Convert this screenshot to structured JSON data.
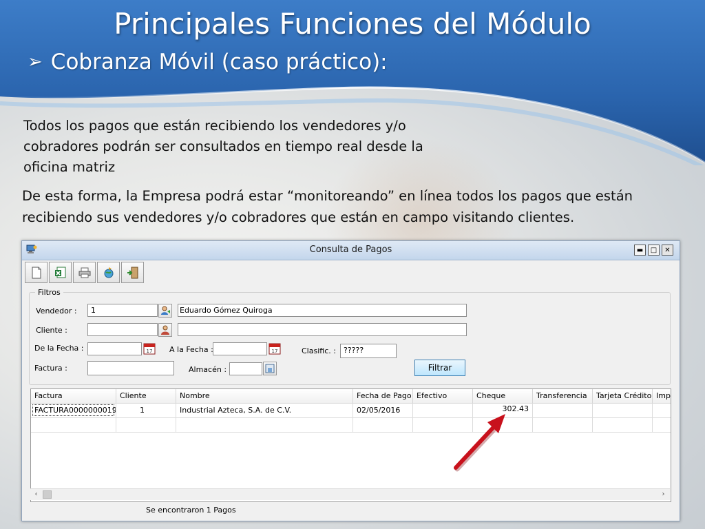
{
  "slide": {
    "title": "Principales Funciones del Módulo",
    "subtitle": "Cobranza Móvil (caso práctico):",
    "paragraph1": "Todos los pagos que están recibiendo los vendedores y/o cobradores podrán ser consultados en tiempo real desde la oficina matriz",
    "paragraph2": "De esta forma, la Empresa podrá estar “monitoreando” en línea todos los pagos que están recibiendo sus vendedores y/o cobradores que están en campo visitando clientes."
  },
  "window": {
    "title": "Consulta de Pagos",
    "controls": {
      "minimize": "▬",
      "maximize": "□",
      "close": "✕"
    }
  },
  "toolbar": {
    "icons": [
      "new-document-icon",
      "excel-export-icon",
      "printer-icon",
      "globe-refresh-icon",
      "exit-door-icon"
    ]
  },
  "filters": {
    "legend": "Filtros",
    "vendedor_label": "Vendedor :",
    "vendedor_value": "1",
    "vendedor_name": "Eduardo Gómez Quiroga",
    "cliente_label": "Cliente :",
    "cliente_value": "",
    "cliente_name": "",
    "de_fecha_label": "De la Fecha :",
    "a_fecha_label": "A la Fecha :",
    "clasif_label": "Clasific. :",
    "clasif_value": "?????",
    "factura_label": "Factura :",
    "almacen_label": "Almacén :",
    "filtrar_label": "Filtrar"
  },
  "grid": {
    "columns": [
      "Factura",
      "Cliente",
      "Nombre",
      "Fecha de Pago",
      "Efectivo",
      "Cheque",
      "Transferencia",
      "Tarjeta Crédito",
      "Imp"
    ],
    "row": {
      "factura": "FACTURA0000000019",
      "cliente": "1",
      "nombre": "Industrial Azteca, S.A. de C.V.",
      "fecha": "02/05/2016",
      "efectivo": "",
      "cheque": "302.43",
      "transferencia": "",
      "tarjeta": "",
      "imp": ""
    }
  },
  "status": "Se encontraron 1 Pagos",
  "colors": {
    "header_blue": "#2f6ab5",
    "arrow_red": "#c8111c"
  }
}
